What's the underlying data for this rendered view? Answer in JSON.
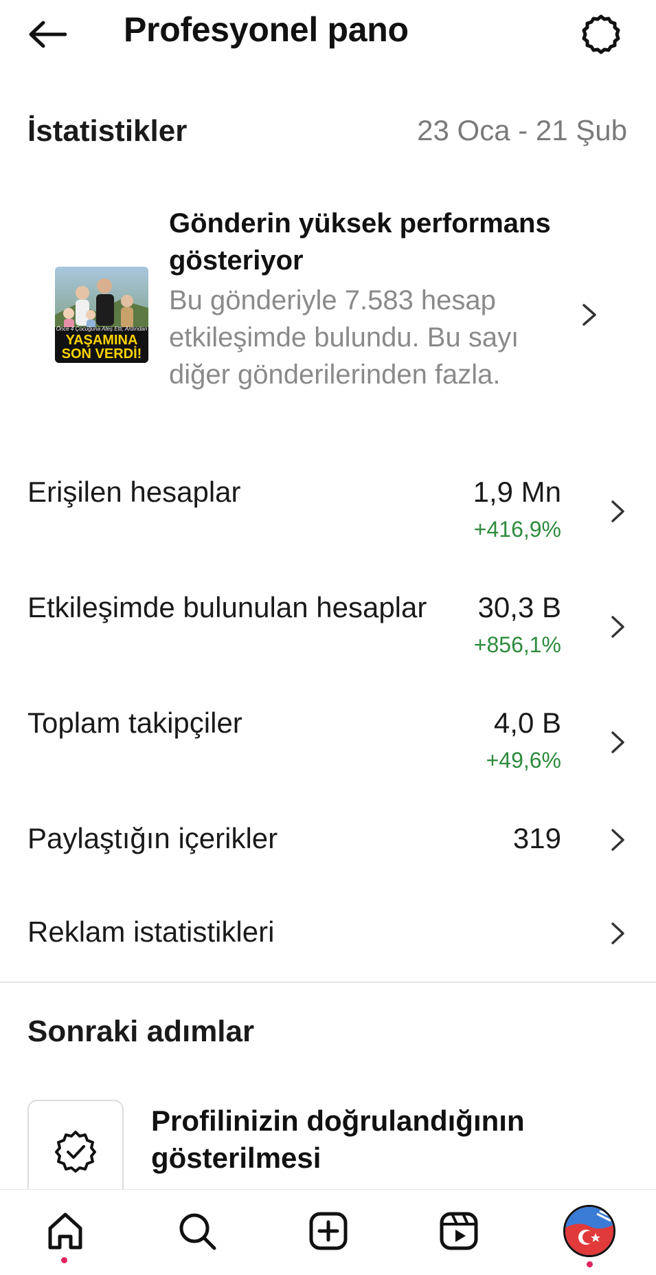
{
  "header": {
    "title": "Profesyonel pano",
    "back_icon": "arrow-left-icon",
    "settings_icon": "settings-gear-icon"
  },
  "insights": {
    "title": "İstatistikler",
    "date_range": "23 Oca - 21 Şub"
  },
  "highlight": {
    "title": "Gönderin yüksek performans gösteriyor",
    "description": "Bu gönderiyle 7.583 hesap etkileşimde bulundu. Bu sayı diğer gönderilerinden fazla.",
    "thumbnail_text_small": "Önce 4 Çocuğuna Ateş Etti, Ardından",
    "thumbnail_text_line1": "YAŞAMINA",
    "thumbnail_text_line2": "SON VERDİ!"
  },
  "metrics": [
    {
      "label": "Erişilen hesaplar",
      "value": "1,9 Mn",
      "change": "+416,9%"
    },
    {
      "label": "Etkileşimde bulunulan hesaplar",
      "value": "30,3 B",
      "change": "+856,1%"
    },
    {
      "label": "Toplam takipçiler",
      "value": "4,0 B",
      "change": "+49,6%"
    },
    {
      "label": "Paylaştığın içerikler",
      "value": "319",
      "change": ""
    },
    {
      "label": "Reklam istatistikleri",
      "value": "",
      "change": ""
    }
  ],
  "next_steps": {
    "title": "Sonraki adımlar",
    "card_title": "Profilinizin doğrulandığının gösterilmesi",
    "card_icon": "verified-badge-icon"
  },
  "bottom_nav": {
    "items": [
      "home-icon",
      "search-icon",
      "create-post-icon",
      "reels-icon",
      "profile-avatar"
    ]
  },
  "colors": {
    "positive_change": "#2e8b3d",
    "secondary_text": "#7a7a7a",
    "notification_dot": "#e0245e"
  }
}
